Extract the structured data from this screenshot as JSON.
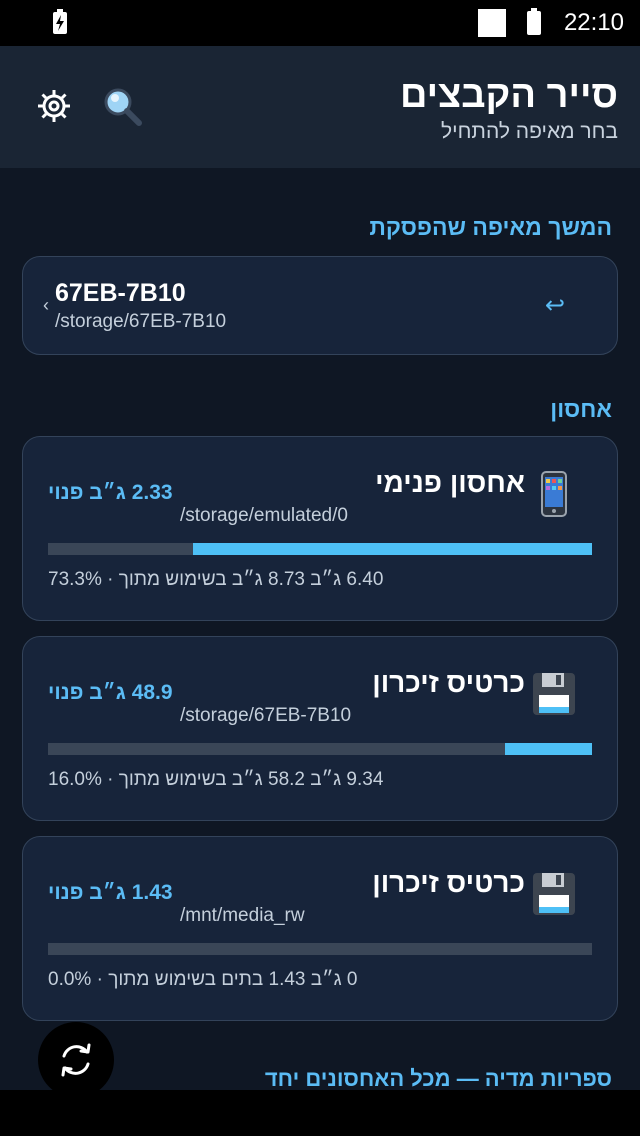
{
  "status_bar": {
    "time": "22:10"
  },
  "app_bar": {
    "title": "סייר הקבצים",
    "subtitle": "בחר מאיפה להתחיל",
    "icons": [
      "gear-icon",
      "search-icon"
    ]
  },
  "resume": {
    "section_title": "המשך מאיפה שהפסקת",
    "name": "67EB-7B10",
    "path": "/storage/67EB-7B10",
    "chevron": "‹",
    "arrow": "↩"
  },
  "storage": {
    "section_title": "אחסון",
    "items": [
      {
        "name": "אחסון פנימי",
        "path": "/storage/emulated/0",
        "free": "2.33 ג״ב פנוי",
        "usage": "6.40 ג״ב 8.73 ג״ב בשימוש מתוך · 73.3%",
        "used_fraction": 0.733,
        "icon": "phone-icon"
      },
      {
        "name": "כרטיס זיכרון",
        "path": "/storage/67EB-7B10",
        "free": "48.9 ג״ב פנוי",
        "usage": "9.34 ג״ב 58.2 ג״ב בשימוש מתוך · 16.0%",
        "used_fraction": 0.16,
        "icon": "floppy-disk-icon"
      },
      {
        "name": "כרטיס זיכרון",
        "path": "/mnt/media_rw",
        "free": "1.43 ג״ב פנוי",
        "usage": "0 ג״ב 1.43 בתים בשימוש מתוך · 0.0%",
        "used_fraction": 0.0,
        "icon": "floppy-disk-icon"
      }
    ]
  },
  "media_section_title": "ספריות מדיה — מכל האחסונים יחד",
  "colors": {
    "accent": "#4ec0f6",
    "background": "#0f1724",
    "card": "#17243a",
    "appbar": "#1a2534"
  }
}
